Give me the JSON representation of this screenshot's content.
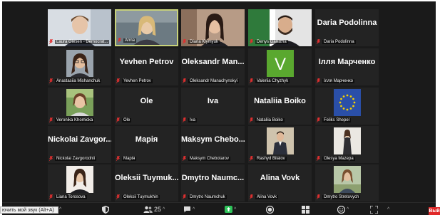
{
  "participants": [
    {
      "label": "Laura Giesen - Democrat...",
      "name": "",
      "video": "woman-short-hair"
    },
    {
      "label": "Anna",
      "name": "",
      "video": "woman-blonde"
    },
    {
      "label": "Diana Klymyuk",
      "name": "",
      "video": "woman-dark-hair"
    },
    {
      "label": "Denys Garuzha",
      "name": "",
      "video": "man-beard-flag"
    },
    {
      "label": "Daria Podolinna",
      "name": "Daria Podolinna",
      "video": ""
    },
    {
      "label": "Anastasiia Mishanchuk",
      "name": "",
      "video": "woman-glasses"
    },
    {
      "label": "Yevhen Petrov",
      "name": "Yevhen Petrov",
      "video": ""
    },
    {
      "label": "Oleksandr Manachynskyi",
      "name": "Oleksandr  Man...",
      "video": ""
    },
    {
      "label": "Valeriia Chyzhyk",
      "name": "",
      "video": "green-v"
    },
    {
      "label": "Ілля Марченко",
      "name": "Ілля Марченко",
      "video": ""
    },
    {
      "label": "Veronika Khomicka",
      "name": "",
      "video": "woman-smiling"
    },
    {
      "label": "Ole",
      "name": "Ole",
      "video": ""
    },
    {
      "label": "Iva",
      "name": "Iva",
      "video": ""
    },
    {
      "label": "Nataliia Boiko",
      "name": "Nataliia Boiko",
      "video": ""
    },
    {
      "label": "Feliks Shepel",
      "name": "",
      "video": "eu-flag"
    },
    {
      "label": "Nickolai Zavgorodnii",
      "name": "Nickolai  Zavgor...",
      "video": ""
    },
    {
      "label": "Марія",
      "name": "Марія",
      "video": ""
    },
    {
      "label": "Maksym Chebotarov",
      "name": "Maksym  Chebo...",
      "video": ""
    },
    {
      "label": "Rashyd Bilalov",
      "name": "",
      "video": "man-suit"
    },
    {
      "label": "Olesya Mazepa",
      "name": "",
      "video": "woman-standing"
    },
    {
      "label": "Liana Torosova",
      "name": "",
      "video": "woman-portrait"
    },
    {
      "label": "Oleksii Tuymukhin",
      "name": "Oleksii  Tuymuk...",
      "video": ""
    },
    {
      "label": "Dmytro Naumchuk",
      "name": "Dmytro  Naumc...",
      "video": ""
    },
    {
      "label": "Alina Vovk",
      "name": "Alina Vovk",
      "video": ""
    },
    {
      "label": "Dmytro Stretovych",
      "name": "",
      "video": "woman-outdoor"
    }
  ],
  "toolbar": {
    "participants_count": "25",
    "tooltip": "ючить мой звук (Alt+A)",
    "leave": "Вый"
  },
  "colors": {
    "window_bg": "#1a1a1a",
    "tile_bg": "#232323",
    "active_border": "#c8d27a",
    "mic_muted": "#e03030",
    "share_green": "#2ec45a",
    "leave_red": "#e02828"
  }
}
